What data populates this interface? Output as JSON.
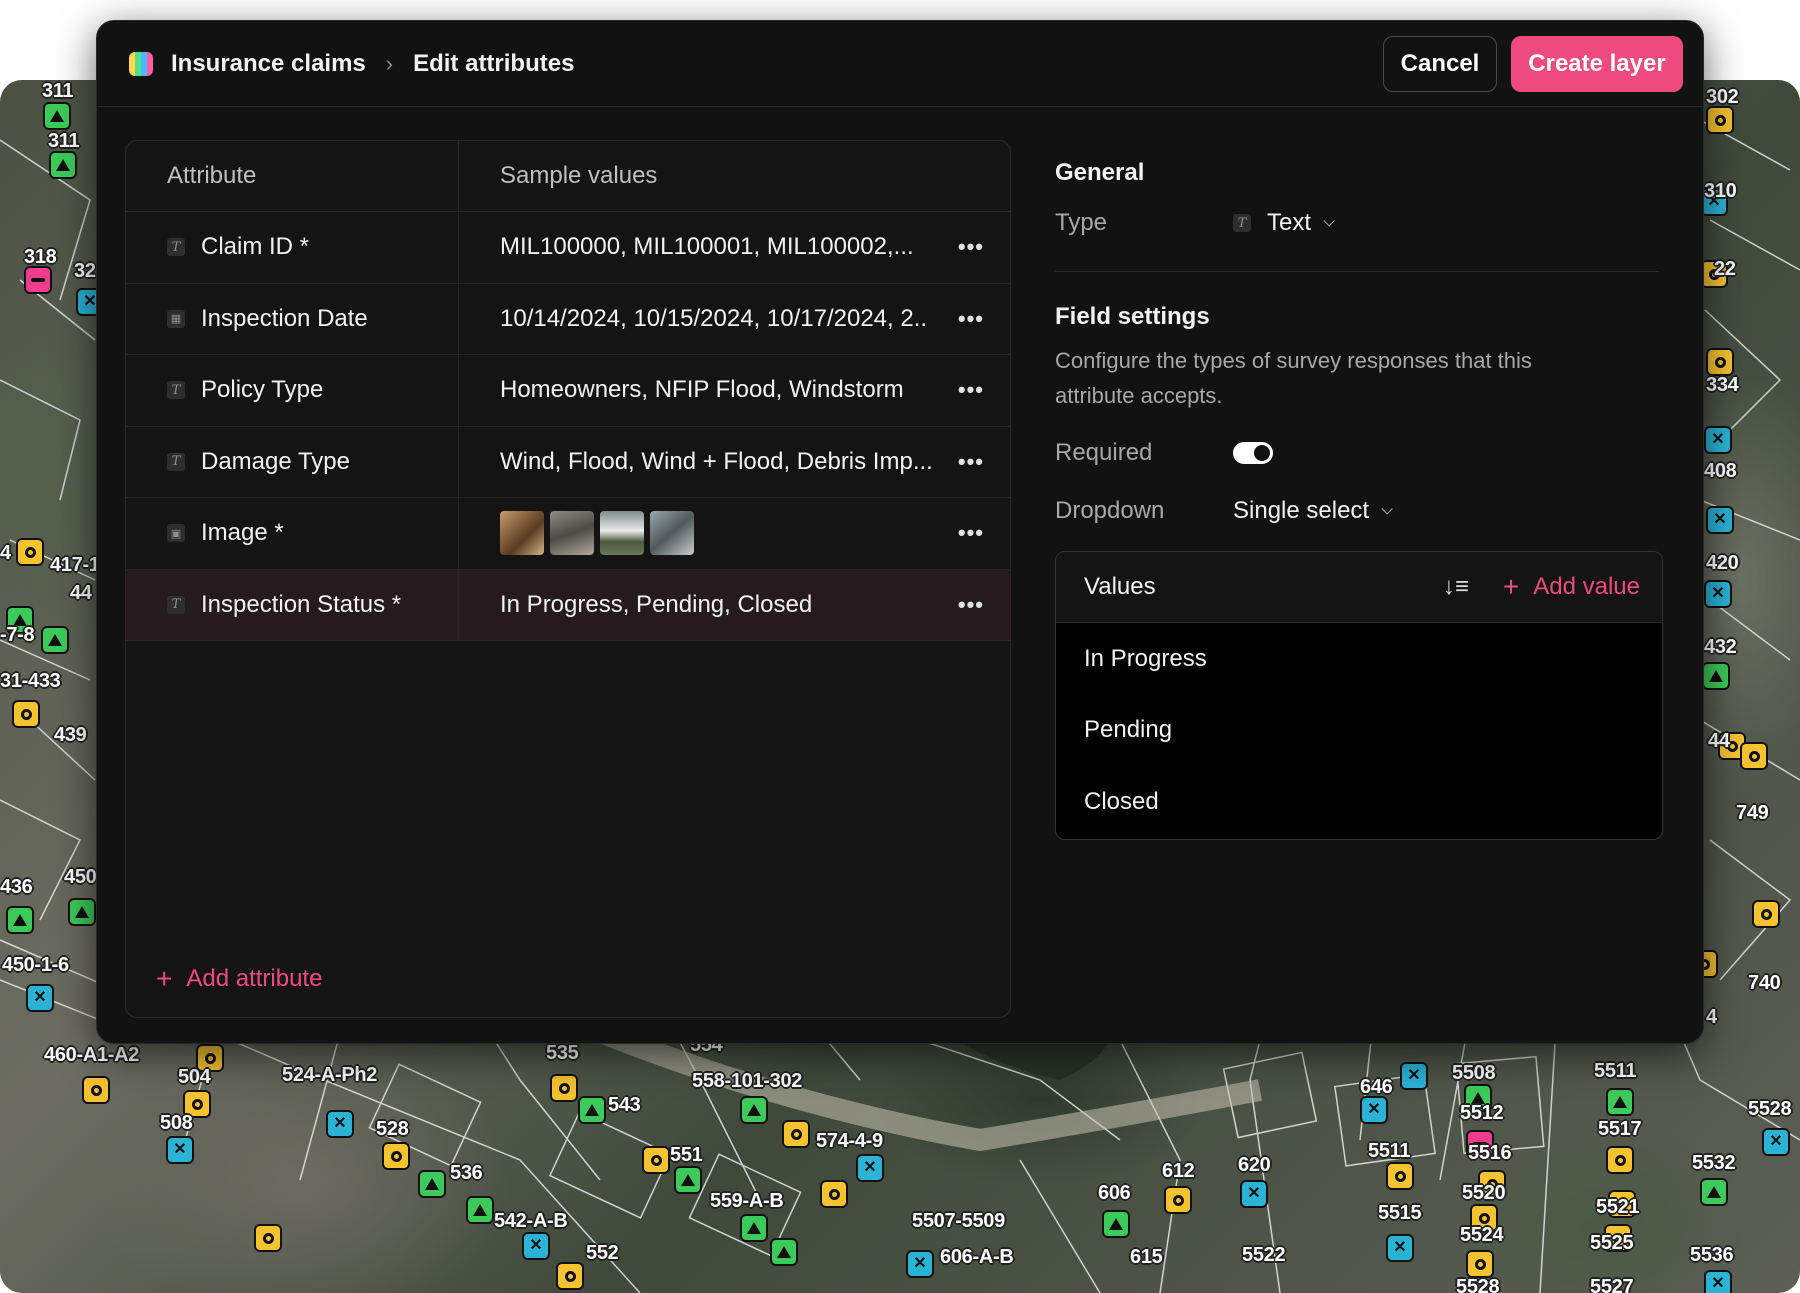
{
  "header": {
    "breadcrumb_root": "Insurance claims",
    "breadcrumb_current": "Edit attributes",
    "cancel_label": "Cancel",
    "create_label": "Create layer",
    "accent_color": "#ef4a7d"
  },
  "table": {
    "col_attribute": "Attribute",
    "col_samples": "Sample values",
    "rows": [
      {
        "type_icon": "text-icon",
        "name": "Claim ID *",
        "samples": "MIL100000, MIL100001, MIL100002,..."
      },
      {
        "type_icon": "calendar-icon",
        "name": "Inspection Date",
        "samples": "10/14/2024, 10/15/2024, 10/17/2024, 2.."
      },
      {
        "type_icon": "text-icon",
        "name": "Policy Type",
        "samples": "Homeowners, NFIP Flood, Windstorm"
      },
      {
        "type_icon": "text-icon",
        "name": "Damage Type",
        "samples": "Wind, Flood, Wind + Flood, Debris Imp..."
      },
      {
        "type_icon": "image-icon",
        "name": "Image *",
        "samples": ""
      },
      {
        "type_icon": "text-icon",
        "name": "Inspection Status *",
        "samples": "In Progress, Pending, Closed"
      }
    ],
    "selected_row": 5,
    "add_attribute_label": "Add attribute"
  },
  "general": {
    "title": "General",
    "type_label": "Type",
    "type_value": "Text"
  },
  "field_settings": {
    "title": "Field settings",
    "description": "Configure the types of survey responses that this attribute accepts.",
    "required_label": "Required",
    "required_on": true,
    "dropdown_label": "Dropdown",
    "dropdown_value": "Single select"
  },
  "values": {
    "title": "Values",
    "add_label": "Add value",
    "items": [
      "In Progress",
      "Pending",
      "Closed"
    ]
  },
  "map_labels": [
    "311",
    "311",
    "318",
    "32",
    "4",
    "417-1",
    "44",
    "-7-8",
    "31-433",
    "439",
    "436",
    "450",
    "450-1-6",
    "460-A1-A2",
    "504",
    "508",
    "524-A-Ph2",
    "528",
    "536",
    "542-A-B",
    "552",
    "535",
    "543",
    "551",
    "558-101-302",
    "574-4-9",
    "559-A-B",
    "5507-5509",
    "606-A-B",
    "606",
    "612",
    "615",
    "620",
    "5522",
    "646",
    "5508",
    "5512",
    "5511",
    "5515",
    "5516",
    "5520",
    "5524",
    "5528",
    "5511",
    "5517",
    "5521",
    "5525",
    "5527",
    "5528",
    "5532",
    "5536",
    "302",
    "310",
    "22",
    "334",
    "408",
    "420",
    "432",
    "44",
    "749",
    "740",
    "4",
    "554"
  ]
}
